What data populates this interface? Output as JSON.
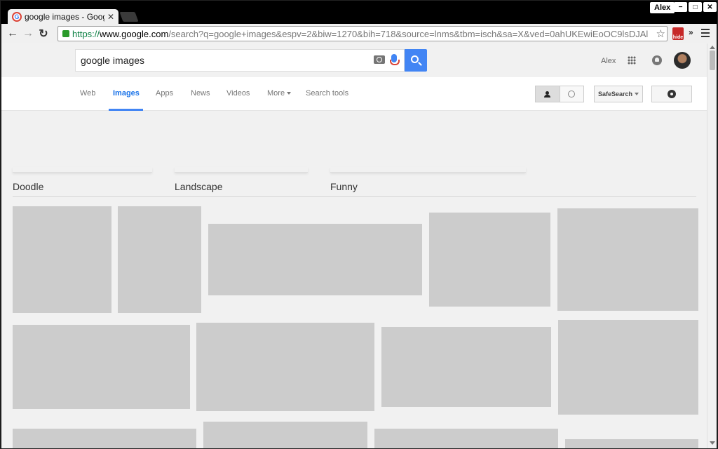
{
  "browser": {
    "tab_title": "google images - Goog",
    "tab_close": "✕",
    "user_chip": "Alex",
    "window_controls": {
      "minimize": "−",
      "maximize": "□",
      "close": "✕"
    },
    "back": "←",
    "forward": "→",
    "reload": "↻",
    "url_scheme": "https://",
    "url_host": "www.google.com",
    "url_path": "/search?q=google+images&espv=2&biw=1270&bih=718&source=lnms&tbm=isch&sa=X&ved=0ahUKEwiEoOC9lsDJAl",
    "bookmark_star": "☆",
    "extension_label": "hide",
    "overflow_chevron": "»"
  },
  "google": {
    "query": "google images",
    "account_name": "Alex",
    "tabs": [
      {
        "label": "Web"
      },
      {
        "label": "Images"
      },
      {
        "label": "Apps"
      },
      {
        "label": "News"
      },
      {
        "label": "Videos"
      },
      {
        "label": "More"
      },
      {
        "label": "Search tools"
      }
    ],
    "safesearch_label": "SafeSearch",
    "related": [
      {
        "label": "Doodle"
      },
      {
        "label": "Landscape"
      },
      {
        "label": "Funny"
      }
    ]
  },
  "colors": {
    "accent": "#4285f4",
    "placeholder_thumb": "#cccccc",
    "page_bg": "#f1f1f1",
    "secure_green": "#0b8043"
  }
}
